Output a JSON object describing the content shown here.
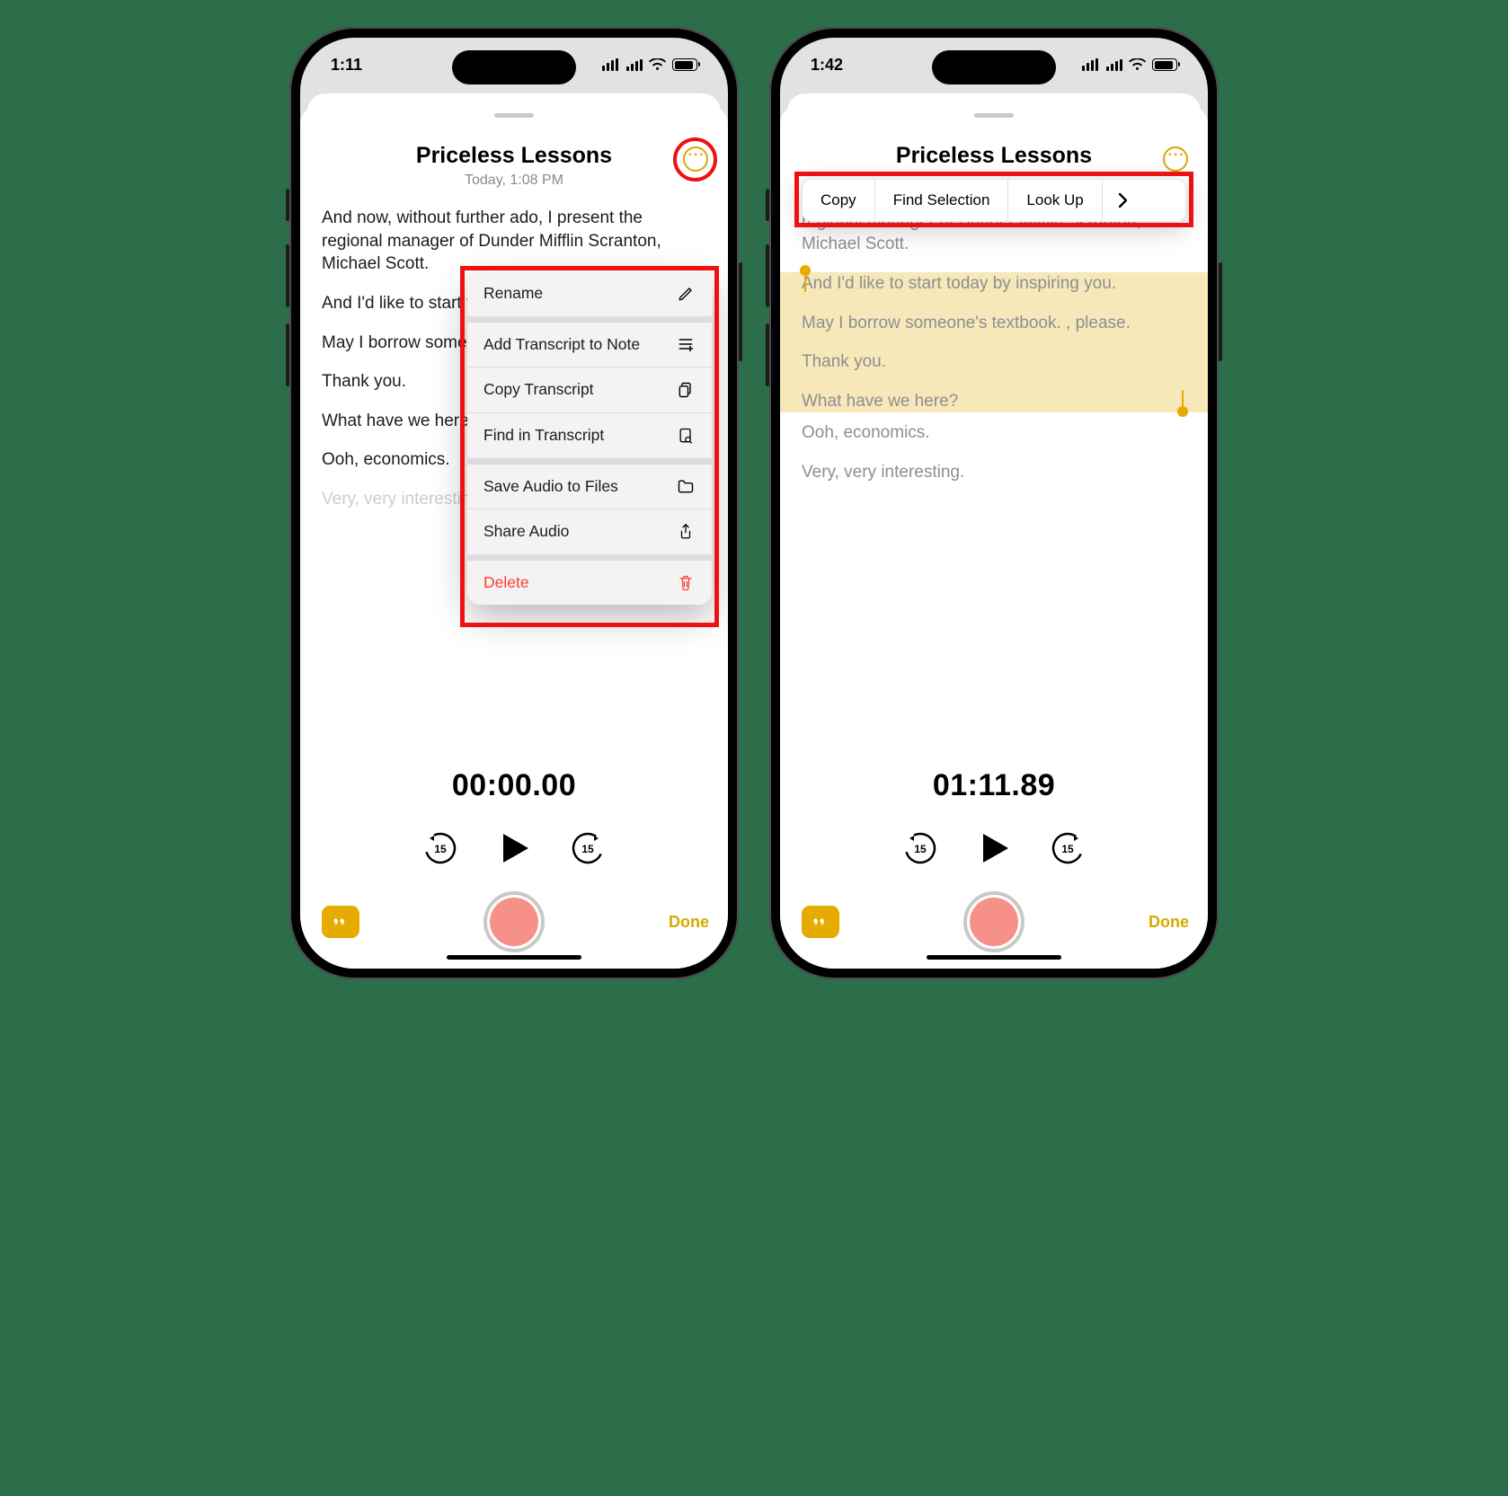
{
  "colors": {
    "accent": "#e6ab00",
    "destructive": "#ff3b30",
    "annotation": "#e11"
  },
  "phones": {
    "left": {
      "status_time": "1:11",
      "title": "Priceless Lessons",
      "subtitle": "Today, 1:08 PM",
      "more_icon": "ellipsis-circle-icon",
      "transcript_lines": [
        "And now, without further ado, I present the regional manager of Dunder Mifflin Scranton, Michael Scott.",
        "And I'd like to start today by inspiring you.",
        "May I borrow someone's textbook. , please.",
        "Thank you.",
        "What have we here?",
        "Ooh, economics.",
        "Very, very interesting."
      ],
      "playback_time": "00:00.00",
      "done_label": "Done",
      "menu": [
        {
          "label": "Rename",
          "icon": "pencil-icon"
        },
        {
          "label": "Add Transcript to Note",
          "icon": "text-add-icon"
        },
        {
          "label": "Copy Transcript",
          "icon": "doc-on-doc-icon"
        },
        {
          "label": "Find in Transcript",
          "icon": "doc-search-icon"
        },
        {
          "label": "Save Audio to Files",
          "icon": "folder-icon"
        },
        {
          "label": "Share Audio",
          "icon": "share-icon"
        },
        {
          "label": "Delete",
          "icon": "trash-icon",
          "destructive": true
        }
      ]
    },
    "right": {
      "status_time": "1:42",
      "title": "Priceless Lessons",
      "more_icon": "ellipsis-circle-icon",
      "popup": {
        "copy": "Copy",
        "find": "Find Selection",
        "lookup": "Look Up",
        "more": "chevron-right-icon"
      },
      "transcript_lines": [
        "And now, without further ado, I present the regional manager of Dunder Mifflin Scranton, Michael Scott.",
        "And I'd like to start today by inspiring you.",
        "May I borrow someone's textbook. , please.",
        "Thank you.",
        "What have we here?",
        "Ooh, economics.",
        "Very, very interesting."
      ],
      "highlighted_range": [
        1,
        4
      ],
      "playback_time": "01:11.89",
      "done_label": "Done"
    }
  }
}
